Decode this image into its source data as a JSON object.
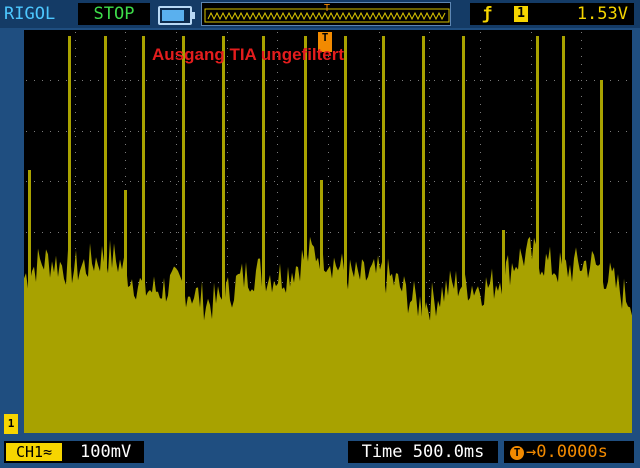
{
  "header": {
    "brand": "RIGOL",
    "run_state": "STOP",
    "battery_icon": "battery-icon",
    "trigger_edge_symbol": "ƒ",
    "trigger_source": "1",
    "trigger_level": "1.53V"
  },
  "screen": {
    "annotation": "Ausgang TIA ungefiltert",
    "trigger_marker": "T",
    "ground_marker": "1",
    "trace_color": "#a8a200",
    "grid_color": "#7a7a7a"
  },
  "footer": {
    "channel_tag": "CH1≈",
    "channel_scale": "100mV",
    "timebase": "Time 500.0ms",
    "trigger_offset_icon": "T",
    "trigger_offset": "→0.0000s"
  }
}
